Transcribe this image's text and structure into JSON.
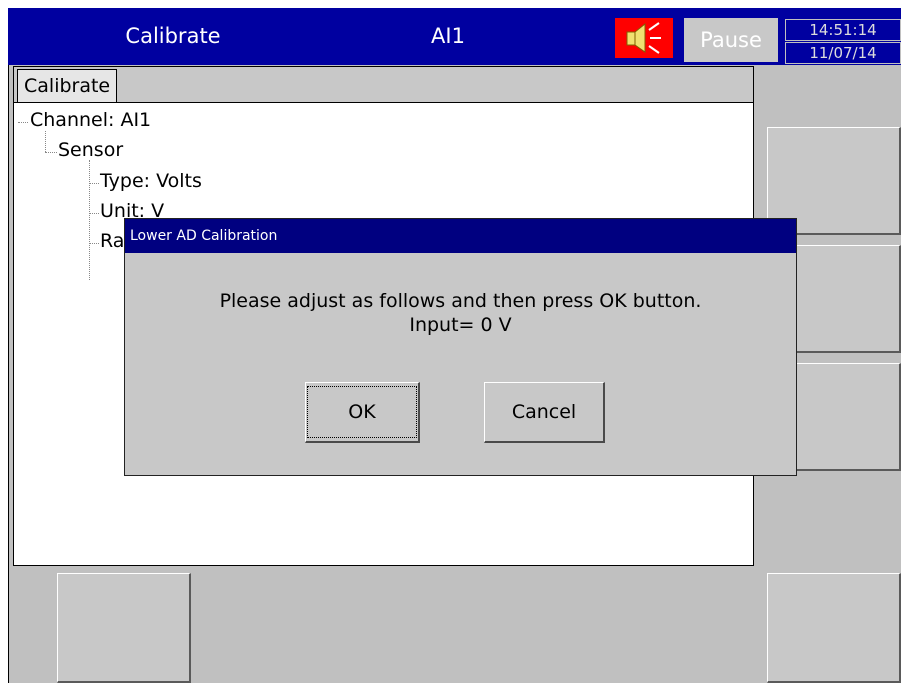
{
  "header": {
    "title": "Calibrate",
    "channel": "AI1",
    "alarm_icon": "speaker-alarm-icon",
    "pause_label": "Pause",
    "time": "14:51:14",
    "date": "11/07/14"
  },
  "panel": {
    "tab_label": "Calibrate",
    "tree": {
      "channel": "Channel: AI1",
      "sensor": "Sensor",
      "type": "Type: Volts",
      "unit": "Unit: V",
      "range_partial": "Ra"
    }
  },
  "dialog": {
    "title": "Lower AD Calibration",
    "message_line1": "Please adjust as follows and then press OK button.",
    "message_line2": "Input= 0 V",
    "ok_label": "OK",
    "cancel_label": "Cancel"
  },
  "colors": {
    "header_bg": "#0000a0",
    "dialog_title_bg": "#000080",
    "alarm_bg": "#ff0000",
    "panel_bg": "#c0c0c0"
  }
}
